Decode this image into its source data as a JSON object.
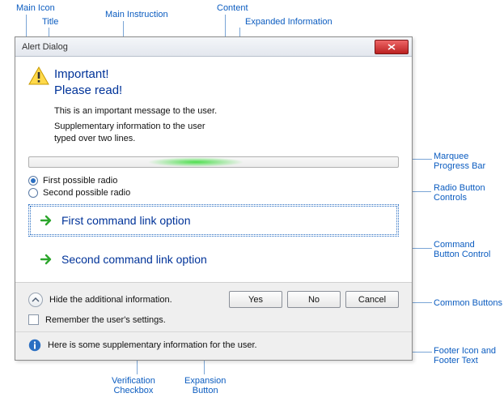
{
  "dialog": {
    "title": "Alert Dialog",
    "main_instruction_1": "Important!",
    "main_instruction_2": "Please read!",
    "content": "This is an important message to the user.",
    "expanded_info_1": "Supplementary information to the user",
    "expanded_info_2": "typed over two lines.",
    "radios": [
      {
        "label": "First possible radio",
        "checked": true
      },
      {
        "label": "Second possible radio",
        "checked": false
      }
    ],
    "commands": [
      "First command link option",
      "Second command link option"
    ],
    "expand_label": "Hide the additional information.",
    "verify_label": "Remember the user's settings.",
    "buttons": {
      "yes": "Yes",
      "no": "No",
      "cancel": "Cancel"
    },
    "footer_text": "Here is some supplementary information for the user."
  },
  "callouts": {
    "main_icon": "Main Icon",
    "title": "Title",
    "main_instruction": "Main Instruction",
    "content": "Content",
    "expanded_info": "Expanded Information",
    "marquee": "Marquee\nProgress Bar",
    "radio_controls": "Radio Button\nControls",
    "command_button": "Command\nButton Control",
    "common_buttons": "Common Buttons",
    "footer_icon_text": "Footer Icon and\nFooter Text",
    "verification": "Verification\nCheckbox",
    "expansion": "Expansion\nButton"
  }
}
